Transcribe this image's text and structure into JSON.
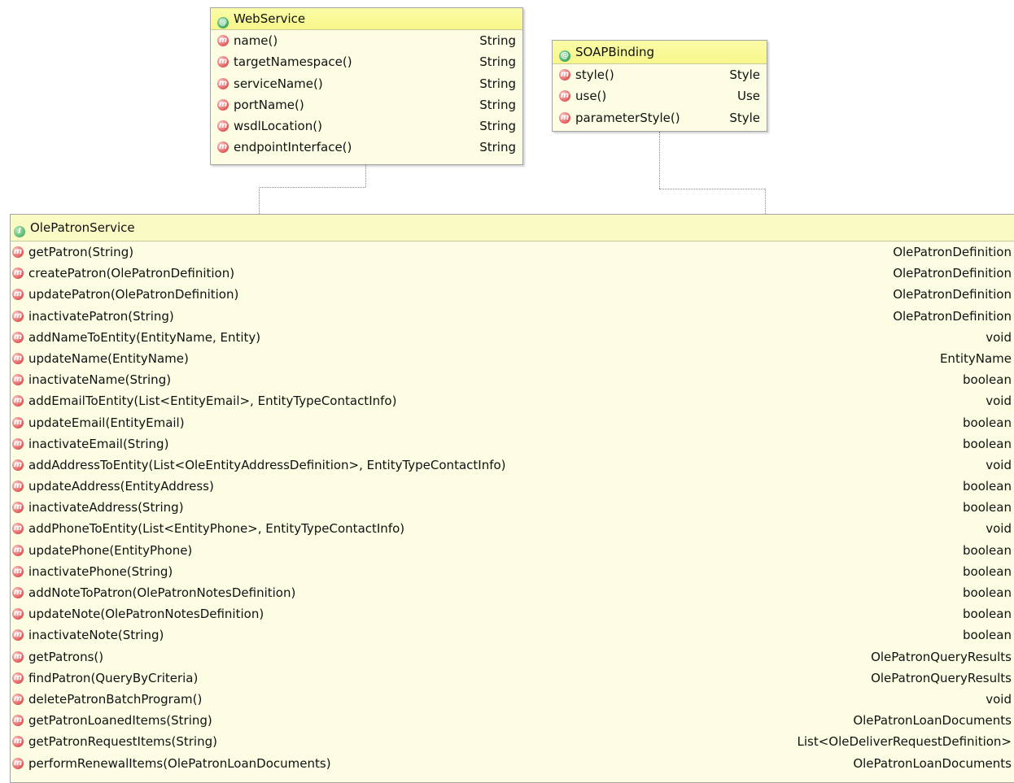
{
  "web_service": {
    "title": "WebService",
    "header_icon": "annotation-icon",
    "methods": [
      {
        "name": "name()",
        "type": "String"
      },
      {
        "name": "targetNamespace()",
        "type": "String"
      },
      {
        "name": "serviceName()",
        "type": "String"
      },
      {
        "name": "portName()",
        "type": "String"
      },
      {
        "name": "wsdlLocation()",
        "type": "String"
      },
      {
        "name": "endpointInterface()",
        "type": "String"
      }
    ]
  },
  "soap_binding": {
    "title": "SOAPBinding",
    "header_icon": "annotation-icon",
    "methods": [
      {
        "name": "style()",
        "type": "Style"
      },
      {
        "name": "use()",
        "type": "Use"
      },
      {
        "name": "parameterStyle()",
        "type": "Style"
      }
    ]
  },
  "ole_patron_service": {
    "title": "OlePatronService",
    "header_icon": "interface-icon",
    "methods": [
      {
        "name": "getPatron(String)",
        "type": "OlePatronDefinition"
      },
      {
        "name": "createPatron(OlePatronDefinition)",
        "type": "OlePatronDefinition"
      },
      {
        "name": "updatePatron(OlePatronDefinition)",
        "type": "OlePatronDefinition"
      },
      {
        "name": "inactivatePatron(String)",
        "type": "OlePatronDefinition"
      },
      {
        "name": "addNameToEntity(EntityName, Entity)",
        "type": "void"
      },
      {
        "name": "updateName(EntityName)",
        "type": "EntityName"
      },
      {
        "name": "inactivateName(String)",
        "type": "boolean"
      },
      {
        "name": "addEmailToEntity(List<EntityEmail>, EntityTypeContactInfo)",
        "type": "void"
      },
      {
        "name": "updateEmail(EntityEmail)",
        "type": "boolean"
      },
      {
        "name": "inactivateEmail(String)",
        "type": "boolean"
      },
      {
        "name": "addAddressToEntity(List<OleEntityAddressDefinition>, EntityTypeContactInfo)",
        "type": "void"
      },
      {
        "name": "updateAddress(EntityAddress)",
        "type": "boolean"
      },
      {
        "name": "inactivateAddress(String)",
        "type": "boolean"
      },
      {
        "name": "addPhoneToEntity(List<EntityPhone>, EntityTypeContactInfo)",
        "type": "void"
      },
      {
        "name": "updatePhone(EntityPhone)",
        "type": "boolean"
      },
      {
        "name": "inactivatePhone(String)",
        "type": "boolean"
      },
      {
        "name": "addNoteToPatron(OlePatronNotesDefinition)",
        "type": "boolean"
      },
      {
        "name": "updateNote(OlePatronNotesDefinition)",
        "type": "boolean"
      },
      {
        "name": "inactivateNote(String)",
        "type": "boolean"
      },
      {
        "name": "getPatrons()",
        "type": "OlePatronQueryResults"
      },
      {
        "name": "findPatron(QueryByCriteria)",
        "type": "OlePatronQueryResults"
      },
      {
        "name": "deletePatronBatchProgram()",
        "type": "void"
      },
      {
        "name": "getPatronLoanedItems(String)",
        "type": "OlePatronLoanDocuments"
      },
      {
        "name": "getPatronRequestItems(String)",
        "type": "List<OleDeliverRequestDefinition>"
      },
      {
        "name": "performRenewalItems(OlePatronLoanDocuments)",
        "type": "OlePatronLoanDocuments"
      }
    ]
  },
  "icons": {
    "method_icon": "method-icon",
    "method_glyph": "m",
    "annotation_glyph": "@",
    "interface_glyph": "I"
  },
  "colors": {
    "header_fill": "#f7f78a",
    "body_fill": "#fdfde4",
    "method_icon": "#e05858",
    "annotation_icon": "#3ea760"
  }
}
